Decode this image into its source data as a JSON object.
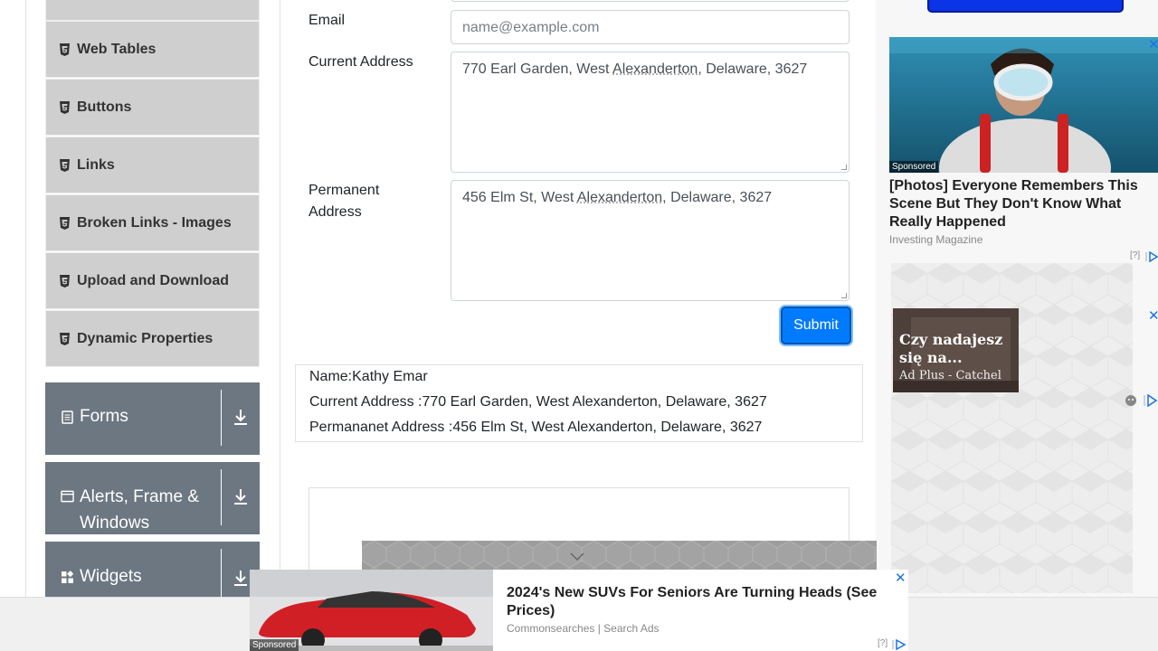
{
  "sidebar": {
    "items": [
      {
        "label": "Web Tables"
      },
      {
        "label": "Buttons"
      },
      {
        "label": "Links"
      },
      {
        "label": "Broken Links - Images"
      },
      {
        "label": "Upload and Download"
      },
      {
        "label": "Dynamic Properties"
      }
    ],
    "groups": [
      {
        "label": "Forms",
        "icon": "document-icon"
      },
      {
        "label": "Alerts, Frame & Windows",
        "label_line1": "Alerts, Frame &",
        "label_line2": "Windows",
        "icon": "window-icon"
      },
      {
        "label": "Widgets",
        "icon": "widgets-icon"
      }
    ]
  },
  "form": {
    "email_label": "Email",
    "email_placeholder": "name@example.com",
    "current_address_label": "Current Address",
    "current_address_value": {
      "pre": "770 Earl Garden, West ",
      "u": "Alexanderton",
      "post": ", Delaware, 3627"
    },
    "permanent_address_label_line1": "Permanent",
    "permanent_address_label_line2": "Address",
    "permanent_address_value": {
      "pre": "456 Elm St, West ",
      "u": "Alexanderton",
      "post": ", Delaware, 3627"
    },
    "submit_label": "Submit"
  },
  "output": {
    "name": "Name:Kathy Emar",
    "current_address": "Current Address :770 Earl Garden, West Alexanderton, Delaware, 3627",
    "permanent_address": "Permananet Address :456 Elm St, West Alexanderton, Delaware, 3627"
  },
  "ads": {
    "right": {
      "sponsored": "Sponsored",
      "title": "[Photos] Everyone Remembers This Scene But They Don't Know What Really Happened",
      "source": "Investing Magazine",
      "help": "[?]"
    },
    "mini": {
      "headline": "Czy nadajesz się na...",
      "headline_line1": "Czy nadajesz",
      "headline_line2": "się na...",
      "sub": "Ad Plus - Catchel"
    },
    "bottom": {
      "sponsored": "Sponsored",
      "title": "2024's New SUVs For Seniors Are Turning Heads (See Prices)",
      "source": "Commonsearches | Search Ads",
      "help": "[?]"
    }
  },
  "colors": {
    "primary": "#007bff",
    "sidebar_group": "#6c7782",
    "sidebar_item": "#cfcfcf"
  }
}
